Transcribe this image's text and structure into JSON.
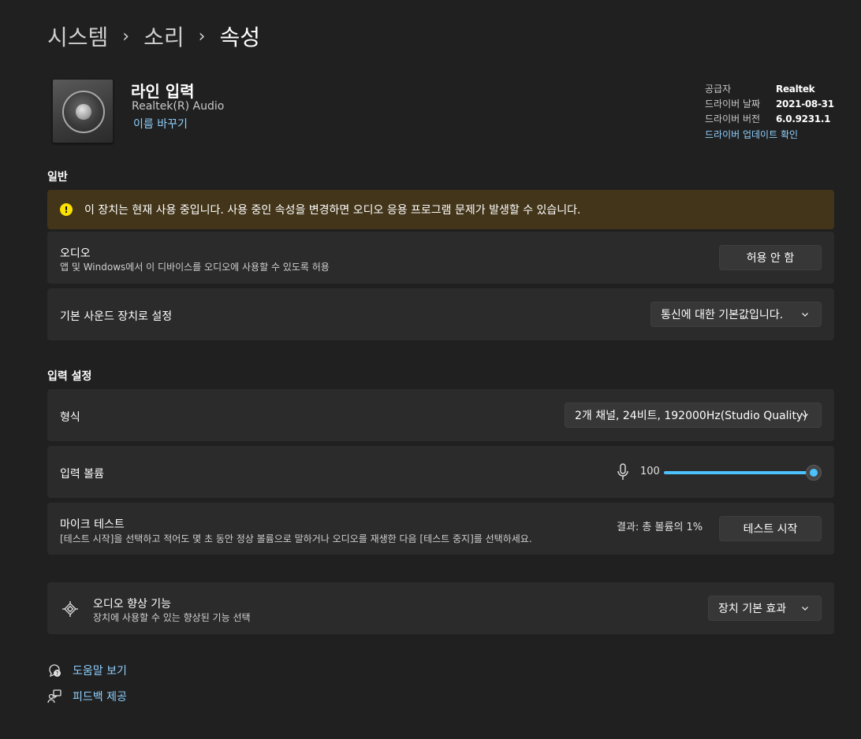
{
  "breadcrumb": {
    "level1": "시스템",
    "level2": "소리",
    "current": "속성"
  },
  "device": {
    "name": "라인 입력",
    "subtitle": "Realtek(R) Audio",
    "rename_link": "이름 바꾸기"
  },
  "driver": {
    "provider_label": "공급자",
    "provider_value": "Realtek",
    "date_label": "드라이버 날짜",
    "date_value": "2021-08-31",
    "version_label": "드라이버 버전",
    "version_value": "6.0.9231.1",
    "update_link": "드라이버 업데이트 확인"
  },
  "general": {
    "title": "일반",
    "warning": "이 장치는 현재 사용 중입니다. 사용 중인 속성을 변경하면 오디오 응용 프로그램 문제가 발생할 수 있습니다.",
    "audio_title": "오디오",
    "audio_desc": "앱 및 Windows에서 이 디바이스를 오디오에 사용할 수 있도록 허용",
    "audio_button": "허용 안 함",
    "default_title": "기본 사운드 장치로 설정",
    "default_dropdown": "통신에 대한 기본값입니다."
  },
  "input": {
    "title": "입력 설정",
    "format_title": "형식",
    "format_value": "2개 채널, 24비트, 192000Hz(Studio Quality)",
    "volume_title": "입력 볼륨",
    "volume_value": "100",
    "volume_level": 1.0,
    "mic_test_title": "마이크 테스트",
    "mic_test_desc": "[테스트 시작]을 선택하고 적어도 몇 초 동안 정상 볼륨으로 말하거나 오디오를 재생한 다음 [테스트 중지]를 선택하세요.",
    "mic_test_result": "결과: 총 볼륨의 1%",
    "mic_test_button": "테스트 시작"
  },
  "enhancements": {
    "title": "오디오 향상 기능",
    "desc": "장치에 사용할 수 있는 향상된 기능 선택",
    "dropdown": "장치 기본 효과"
  },
  "links": {
    "help": "도움말 보기",
    "feedback": "피드백 제공"
  },
  "colors": {
    "accent": "#4cc2ff",
    "link": "#8fd0ff",
    "warning_bg": "#433519",
    "warning_icon": "#fce100"
  }
}
